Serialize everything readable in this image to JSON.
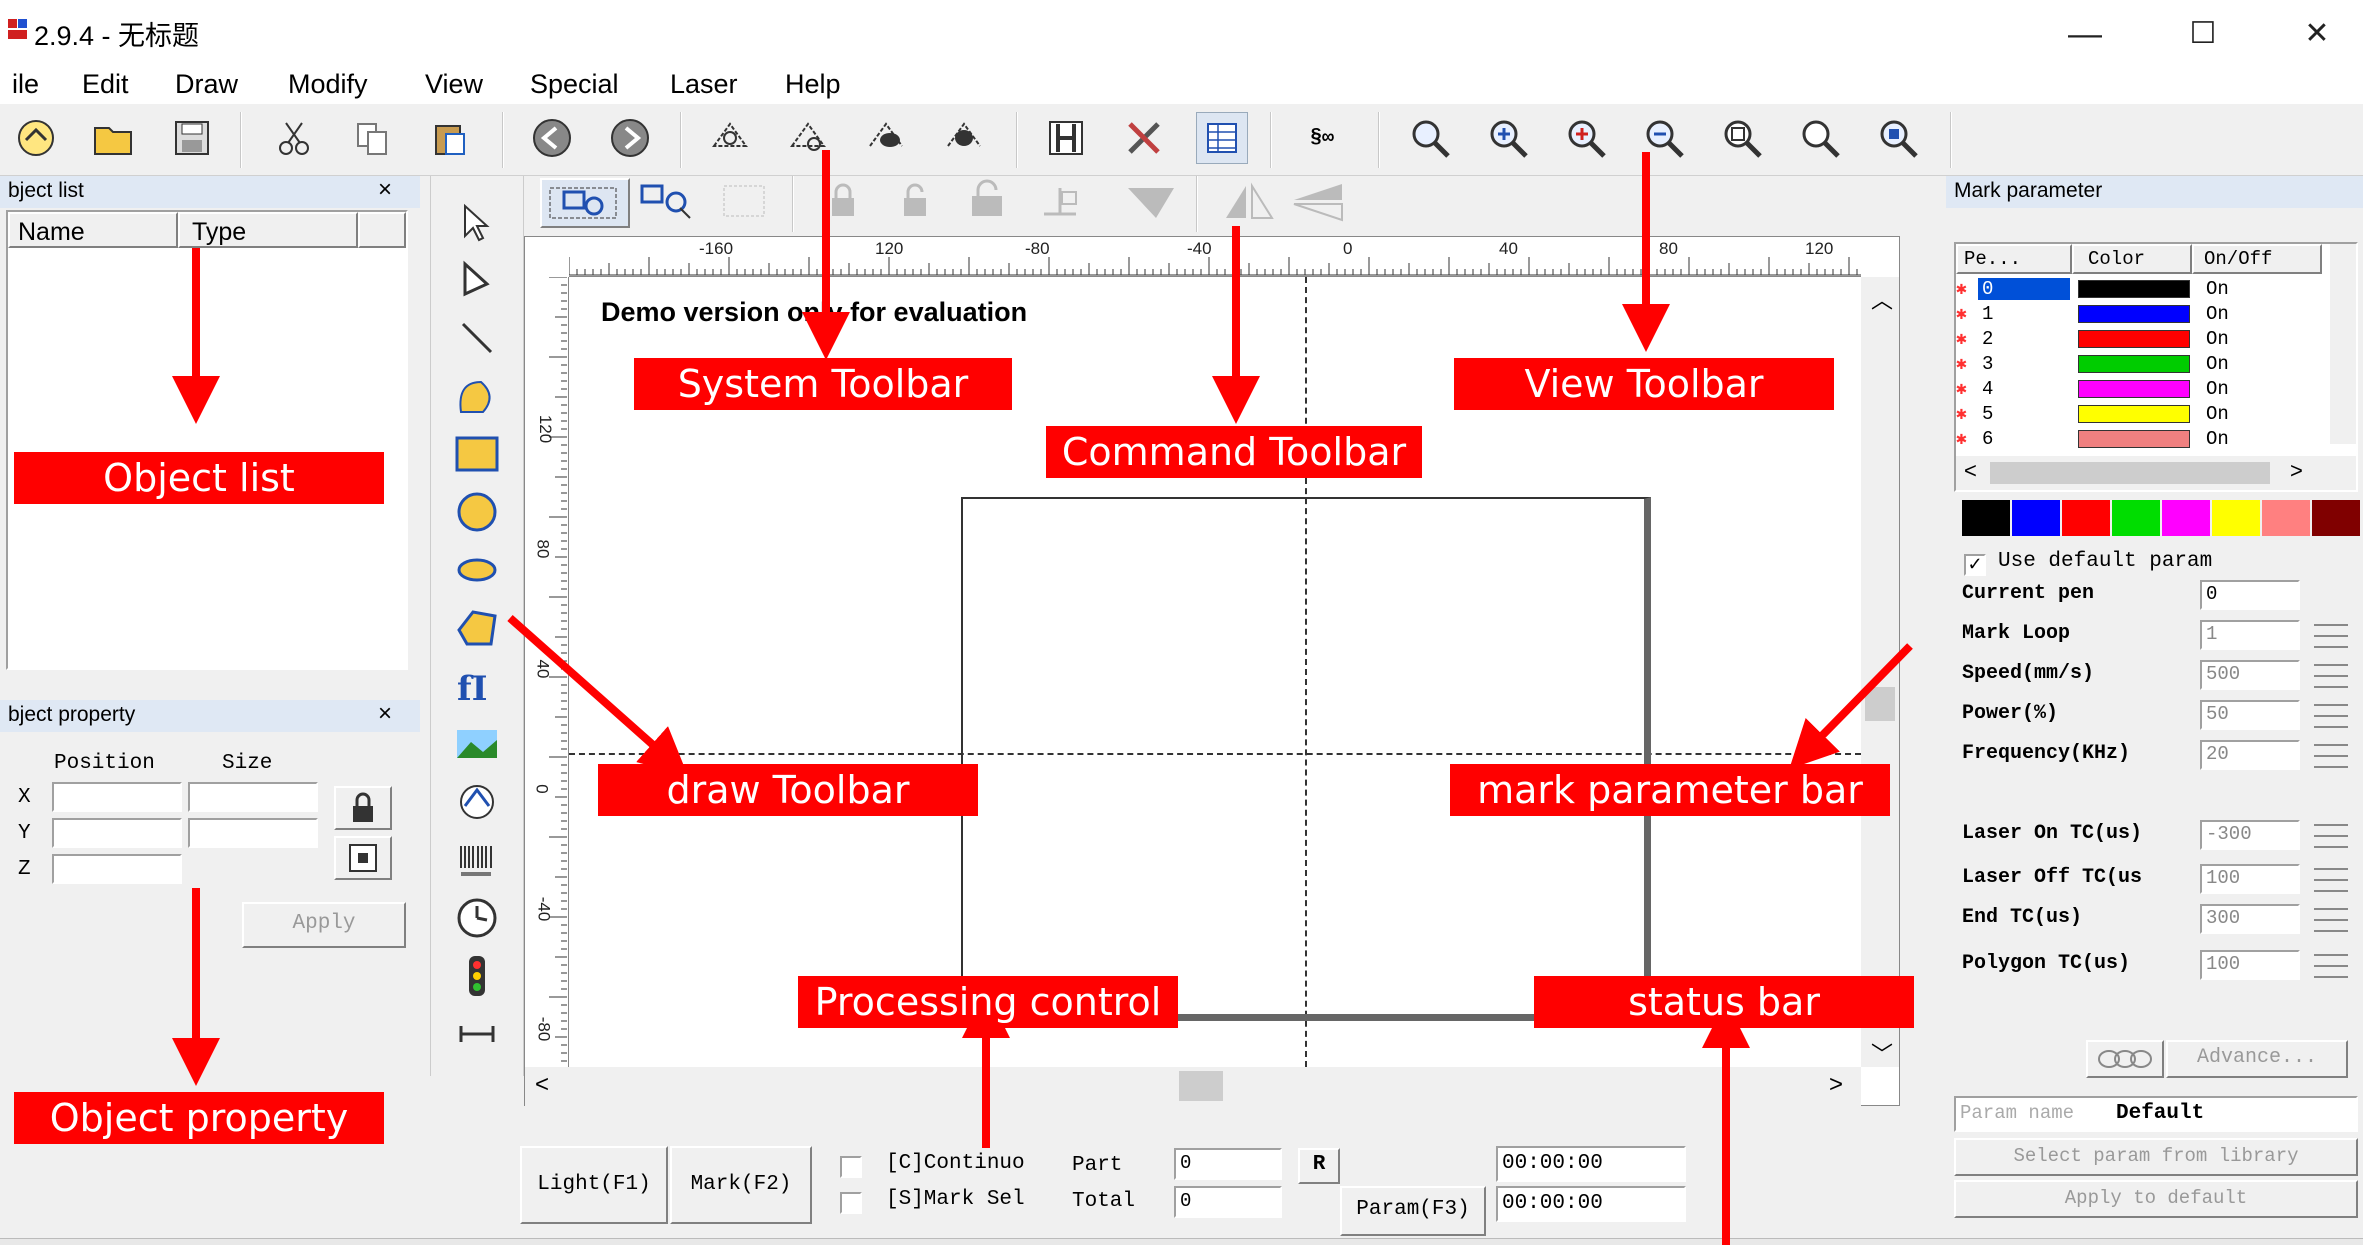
{
  "window": {
    "title": "2.9.4 - 无标题",
    "min": "—",
    "max": "☐",
    "close": "✕"
  },
  "menu": [
    "ile",
    "Edit",
    "Draw",
    "Modify",
    "View",
    "Special",
    "Laser",
    "Help"
  ],
  "object_list": {
    "title": "bject list",
    "close": "×",
    "col_name": "Name",
    "col_type": "Type"
  },
  "object_property": {
    "title": "bject property",
    "close": "×",
    "position": "Position",
    "size": "Size",
    "x": "X",
    "y": "Y",
    "z": "Z",
    "apply": "Apply"
  },
  "canvas": {
    "demo_text": "Demo version only for evaluation",
    "ruler_top": [
      "-160",
      "120",
      "-80",
      "-40",
      "0",
      "40",
      "80",
      "120"
    ],
    "ruler_left": [
      "120",
      "80",
      "40",
      "0",
      "-40",
      "-80"
    ]
  },
  "mark_parameter": {
    "title": "Mark parameter",
    "col_pen": "Pe...",
    "col_color": "Color",
    "col_onoff": "On/Off",
    "pens": [
      {
        "id": "0",
        "color": "#000000",
        "state": "On"
      },
      {
        "id": "1",
        "color": "#0000ff",
        "state": "On"
      },
      {
        "id": "2",
        "color": "#ff0000",
        "state": "On"
      },
      {
        "id": "3",
        "color": "#00cc00",
        "state": "On"
      },
      {
        "id": "4",
        "color": "#ff00ff",
        "state": "On"
      },
      {
        "id": "5",
        "color": "#ffff00",
        "state": "On"
      },
      {
        "id": "6",
        "color": "#f08080",
        "state": "On"
      }
    ],
    "palette": [
      "#000000",
      "#0000ff",
      "#ff0000",
      "#00dd00",
      "#ff00ff",
      "#ffff00",
      "#ff8080",
      "#800000"
    ],
    "use_default": "Use default param",
    "params": [
      {
        "label": "Current pen",
        "value": "0"
      },
      {
        "label": "Mark Loop",
        "value": "1"
      },
      {
        "label": "Speed(mm/s)",
        "value": "500"
      },
      {
        "label": "Power(%)",
        "value": "50"
      },
      {
        "label": "Frequency(KHz)",
        "value": "20"
      },
      {
        "label": "Laser On TC(us)",
        "value": "-300"
      },
      {
        "label": "Laser Off TC(us",
        "value": "100"
      },
      {
        "label": "End TC(us)",
        "value": "300"
      },
      {
        "label": "Polygon TC(us)",
        "value": "100"
      }
    ],
    "advance": "Advance...",
    "param_name_label": "Param name",
    "param_name_value": "Default",
    "select_from_library": "Select param from library",
    "apply_to_default": "Apply to default"
  },
  "processing": {
    "light": "Light(F1)",
    "mark": "Mark(F2)",
    "continuous": "[C]Continuo",
    "mark_sel": "[S]Mark Sel",
    "part": "Part",
    "total": "Total",
    "part_value": "0",
    "total_value": "0",
    "r": "R",
    "param": "Param(F3)",
    "time1": "00:00:00",
    "time2": "00:00:00"
  },
  "annotations": {
    "system_toolbar": "System Toolbar",
    "command_toolbar": "Command Toolbar",
    "view_toolbar": "View Toolbar",
    "object_list": "Object list",
    "draw_toolbar": "draw Toolbar",
    "mark_parameter_bar": "mark parameter bar",
    "processing_control": "Processing control",
    "status_bar": "status bar",
    "object_property": "Object property"
  },
  "colors": {
    "annotation": "#ff0000",
    "panel_title": "#dfe8f4"
  }
}
